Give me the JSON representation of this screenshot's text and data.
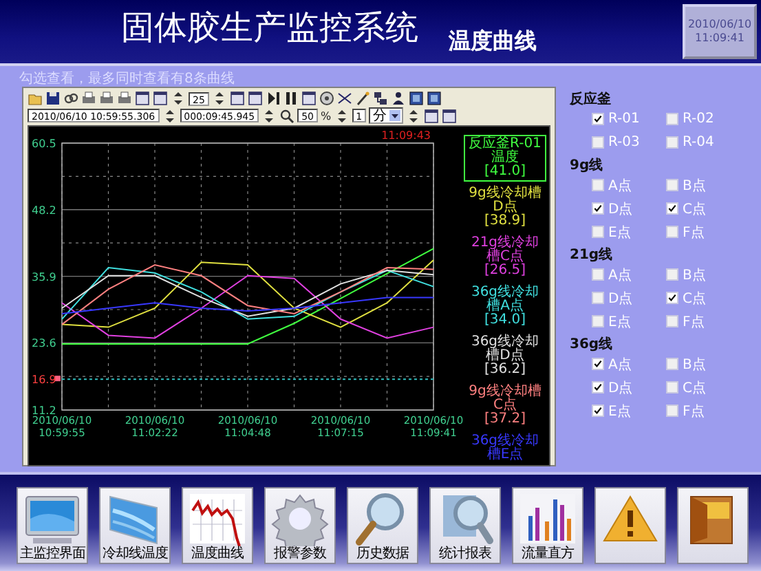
{
  "header": {
    "title": "固体胶生产监控系统",
    "subtitle": "温度曲线",
    "date": "2010/06/10",
    "time": "11:09:41"
  },
  "hint": "勾选查看，最多同时查看有8条曲线",
  "toolbar": {
    "step_value": "25",
    "start_time": "2010/06/10 10:59:55.306",
    "duration": "000:09:45.945",
    "zoom_percent": "50",
    "percent_unit": "%",
    "interval": "1",
    "interval_unit": "分"
  },
  "chart": {
    "cursor_time": "11:09:43",
    "legend": [
      {
        "value": "[41.0]",
        "selected": true
      },
      {
        "value": "[38.9]",
        "selected": false
      },
      {
        "value": "[26.5]",
        "selected": false
      },
      {
        "value": "[34.0]",
        "selected": false
      },
      {
        "value": "[36.2]",
        "selected": false
      },
      {
        "value": "[37.2]",
        "selected": false
      },
      {
        "selected": false
      }
    ],
    "chart_data": {
      "type": "line",
      "categories": [
        "2010/06/10 10:59:55",
        null,
        "2010/06/10 11:02:22",
        null,
        "2010/06/10 11:04:48",
        null,
        "2010/06/10 11:07:15",
        null,
        "2010/06/10 11:09:41"
      ],
      "ylim": [
        11.2,
        60.5
      ],
      "yticks": [
        11.2,
        {
          "value": 16.9,
          "label": "16.9"
        },
        23.6,
        35.9,
        48.2,
        60.5
      ],
      "grid": true,
      "series": [
        {
          "name": "反应釜R-01温度",
          "color": "#40ff40",
          "values": [
            23.4,
            23.4,
            23.4,
            23.4,
            23.4,
            27.2,
            31.8,
            36.4,
            41.0
          ]
        },
        {
          "name": "9g线冷却槽D点",
          "color": "#e0e040",
          "values": [
            27.0,
            26.5,
            30.0,
            38.5,
            38.0,
            30.0,
            26.5,
            31.0,
            38.9
          ]
        },
        {
          "name": "21g线冷却槽C点",
          "color": "#e040e0",
          "values": [
            31.0,
            25.0,
            24.5,
            30.0,
            36.0,
            35.5,
            28.0,
            24.5,
            26.5
          ]
        },
        {
          "name": "36g线冷却槽A点",
          "color": "#40e0e0",
          "values": [
            28.0,
            37.5,
            36.5,
            33.0,
            28.0,
            28.5,
            33.0,
            37.0,
            34.0
          ]
        },
        {
          "name": "36g线冷却槽D点",
          "color": "#e0e0e0",
          "values": [
            30.0,
            36.0,
            36.0,
            32.0,
            28.5,
            30.0,
            34.5,
            37.0,
            36.2
          ]
        },
        {
          "name": "9g线冷却槽C点",
          "color": "#ff8080",
          "values": [
            27.0,
            33.5,
            38.0,
            36.0,
            30.5,
            29.0,
            33.0,
            37.5,
            37.2
          ]
        },
        {
          "name": "36g线冷却槽E点",
          "color": "#3838ff",
          "values": [
            29.0,
            30.0,
            31.0,
            30.0,
            29.5,
            30.0,
            31.0,
            32.0,
            32.0
          ]
        },
        {
          "color": "#30c0c0",
          "line_style": "dashed",
          "values": [
            16.9,
            16.9,
            16.9,
            16.9,
            16.9,
            16.9,
            16.9,
            16.9,
            16.9
          ]
        }
      ]
    }
  },
  "selector": {
    "groups": [
      {
        "title": "反应釜",
        "options": [
          {
            "label": "R-01",
            "checked": true
          },
          {
            "label": "R-02",
            "checked": false
          },
          {
            "label": "R-03",
            "checked": false
          },
          {
            "label": "R-04",
            "checked": false
          }
        ]
      },
      {
        "title": "9g线",
        "options": [
          {
            "label": "A点",
            "checked": false
          },
          {
            "label": "B点",
            "checked": false
          },
          {
            "label": "D点",
            "checked": true
          },
          {
            "label": "C点",
            "checked": true
          },
          {
            "label": "E点",
            "checked": false
          },
          {
            "label": "F点",
            "checked": false
          }
        ]
      },
      {
        "title": "21g线",
        "options": [
          {
            "label": "A点",
            "checked": false
          },
          {
            "label": "B点",
            "checked": false
          },
          {
            "label": "D点",
            "checked": false
          },
          {
            "label": "C点",
            "checked": true
          },
          {
            "label": "E点",
            "checked": false
          },
          {
            "label": "F点",
            "checked": false
          }
        ]
      },
      {
        "title": "36g线",
        "options": [
          {
            "label": "A点",
            "checked": true
          },
          {
            "label": "B点",
            "checked": false
          },
          {
            "label": "D点",
            "checked": true
          },
          {
            "label": "C点",
            "checked": false
          },
          {
            "label": "E点",
            "checked": true
          },
          {
            "label": "F点",
            "checked": false
          }
        ]
      }
    ]
  },
  "nav": [
    {
      "label": "主监控界面",
      "kind": "monitor"
    },
    {
      "label": "冷却线温度",
      "kind": "panel"
    },
    {
      "label": "温度曲线",
      "kind": "chart"
    },
    {
      "label": "报警参数",
      "kind": "gear"
    },
    {
      "label": "历史数据",
      "kind": "magnifier"
    },
    {
      "label": "统计报表",
      "kind": "magnifier_doc"
    },
    {
      "label": "流量直方",
      "kind": "bars"
    },
    {
      "kind": "warning"
    },
    {
      "kind": "exit"
    }
  ]
}
